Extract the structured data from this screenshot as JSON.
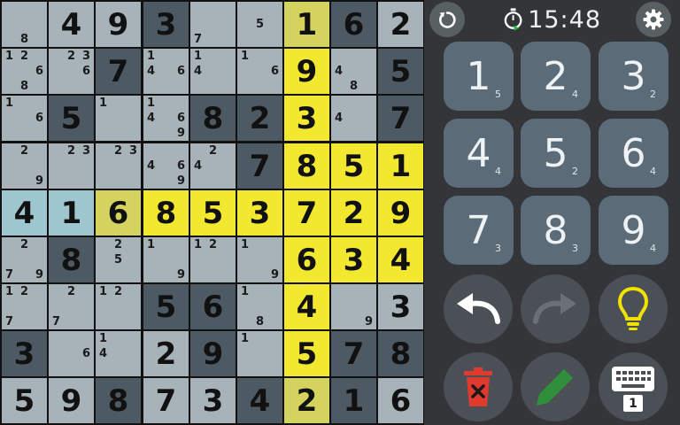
{
  "board": {
    "rows": [
      [
        {
          "b": "light",
          "n": [
            8
          ]
        },
        {
          "b": "light",
          "v": "4"
        },
        {
          "b": "light",
          "v": "9"
        },
        {
          "b": "dark",
          "v": "3"
        },
        {
          "b": "light",
          "n": [
            7
          ]
        },
        {
          "b": "light",
          "n": [
            5
          ]
        },
        {
          "b": "olive",
          "v": "1"
        },
        {
          "b": "dark",
          "v": "6"
        },
        {
          "b": "light",
          "v": "2"
        }
      ],
      [
        {
          "b": "light",
          "n": [
            1,
            2,
            6,
            8
          ]
        },
        {
          "b": "light",
          "n": [
            2,
            3,
            6
          ]
        },
        {
          "b": "dark",
          "v": "7"
        },
        {
          "b": "light",
          "n": [
            1,
            4,
            6
          ]
        },
        {
          "b": "light",
          "n": [
            1,
            4
          ]
        },
        {
          "b": "light",
          "n": [
            1,
            6
          ]
        },
        {
          "b": "yellow",
          "v": "9"
        },
        {
          "b": "light",
          "n": [
            4,
            8
          ]
        },
        {
          "b": "dark",
          "v": "5"
        }
      ],
      [
        {
          "b": "light",
          "n": [
            1,
            6
          ]
        },
        {
          "b": "dark",
          "v": "5"
        },
        {
          "b": "light",
          "n": [
            1
          ]
        },
        {
          "b": "light",
          "n": [
            1,
            4,
            6,
            9
          ]
        },
        {
          "b": "dark",
          "v": "8"
        },
        {
          "b": "dark",
          "v": "2"
        },
        {
          "b": "yellow",
          "v": "3"
        },
        {
          "b": "light",
          "n": [
            4
          ]
        },
        {
          "b": "dark",
          "v": "7"
        }
      ],
      [
        {
          "b": "light",
          "n": [
            2,
            9
          ]
        },
        {
          "b": "light",
          "n": [
            2,
            3
          ]
        },
        {
          "b": "light",
          "n": [
            2,
            3
          ]
        },
        {
          "b": "light",
          "n": [
            4,
            6,
            9
          ]
        },
        {
          "b": "light",
          "n": [
            2,
            4
          ]
        },
        {
          "b": "dark",
          "v": "7"
        },
        {
          "b": "yellow",
          "v": "8"
        },
        {
          "b": "yellow",
          "v": "5"
        },
        {
          "b": "yellow",
          "v": "1"
        }
      ],
      [
        {
          "b": "blue",
          "v": "4"
        },
        {
          "b": "blue",
          "v": "1"
        },
        {
          "b": "olive",
          "v": "6"
        },
        {
          "b": "yellow",
          "v": "8"
        },
        {
          "b": "yellow",
          "v": "5"
        },
        {
          "b": "yellow",
          "v": "3"
        },
        {
          "b": "yellow",
          "v": "7"
        },
        {
          "b": "yellow",
          "v": "2"
        },
        {
          "b": "yellow",
          "v": "9"
        }
      ],
      [
        {
          "b": "light",
          "n": [
            2,
            7,
            9
          ]
        },
        {
          "b": "dark",
          "v": "8"
        },
        {
          "b": "light",
          "n": [
            2,
            5
          ]
        },
        {
          "b": "light",
          "n": [
            1,
            9
          ]
        },
        {
          "b": "light",
          "n": [
            1,
            2
          ]
        },
        {
          "b": "light",
          "n": [
            1,
            9
          ]
        },
        {
          "b": "yellow",
          "v": "6"
        },
        {
          "b": "yellow",
          "v": "3"
        },
        {
          "b": "yellow",
          "v": "4"
        }
      ],
      [
        {
          "b": "light",
          "n": [
            1,
            2,
            7
          ]
        },
        {
          "b": "light",
          "n": [
            2,
            7
          ]
        },
        {
          "b": "light",
          "n": [
            1,
            2
          ]
        },
        {
          "b": "dark",
          "v": "5"
        },
        {
          "b": "dark",
          "v": "6"
        },
        {
          "b": "light",
          "n": [
            1,
            8
          ]
        },
        {
          "b": "yellow",
          "v": "4"
        },
        {
          "b": "light",
          "n": [
            9
          ]
        },
        {
          "b": "light",
          "v": "3"
        }
      ],
      [
        {
          "b": "dark",
          "v": "3"
        },
        {
          "b": "light",
          "n": [
            6
          ]
        },
        {
          "b": "light",
          "n": [
            1,
            4
          ]
        },
        {
          "b": "light",
          "v": "2"
        },
        {
          "b": "dark",
          "v": "9"
        },
        {
          "b": "light",
          "n": [
            1
          ]
        },
        {
          "b": "yellow",
          "v": "5"
        },
        {
          "b": "dark",
          "v": "7"
        },
        {
          "b": "dark",
          "v": "8"
        }
      ],
      [
        {
          "b": "light",
          "v": "5"
        },
        {
          "b": "light",
          "v": "9"
        },
        {
          "b": "dark",
          "v": "8"
        },
        {
          "b": "light",
          "v": "7"
        },
        {
          "b": "light",
          "v": "3"
        },
        {
          "b": "dark",
          "v": "4"
        },
        {
          "b": "olive",
          "v": "2"
        },
        {
          "b": "dark",
          "v": "1"
        },
        {
          "b": "light",
          "v": "6"
        }
      ]
    ]
  },
  "timer": {
    "time": "15:48"
  },
  "numpad": [
    {
      "digit": "1",
      "count": "5"
    },
    {
      "digit": "2",
      "count": "4"
    },
    {
      "digit": "3",
      "count": "2"
    },
    {
      "digit": "4",
      "count": "4"
    },
    {
      "digit": "5",
      "count": "2"
    },
    {
      "digit": "6",
      "count": "4"
    },
    {
      "digit": "7",
      "count": "3"
    },
    {
      "digit": "8",
      "count": "3"
    },
    {
      "digit": "9",
      "count": "4"
    }
  ],
  "input_mode": {
    "badge": "1"
  },
  "icons": {
    "restart": "restart-icon",
    "settings": "gear-icon",
    "timer": "stopwatch-icon",
    "undo": "undo-icon",
    "redo": "redo-icon",
    "hint": "lightbulb-icon",
    "erase": "trash-icon",
    "pencil": "pencil-icon",
    "keyboard": "keyboard-icon"
  },
  "colors": {
    "cell_light": "#a7b2b9",
    "cell_dark": "#4d5a63",
    "highlight_yellow": "#f3e830",
    "highlight_olive": "#d4d35e",
    "selected_blue": "#9ec6cf",
    "button": "#5b6c78",
    "hint_yellow": "#f1e000",
    "erase_red": "#e03a2f",
    "pencil_green": "#2f8f3a"
  }
}
